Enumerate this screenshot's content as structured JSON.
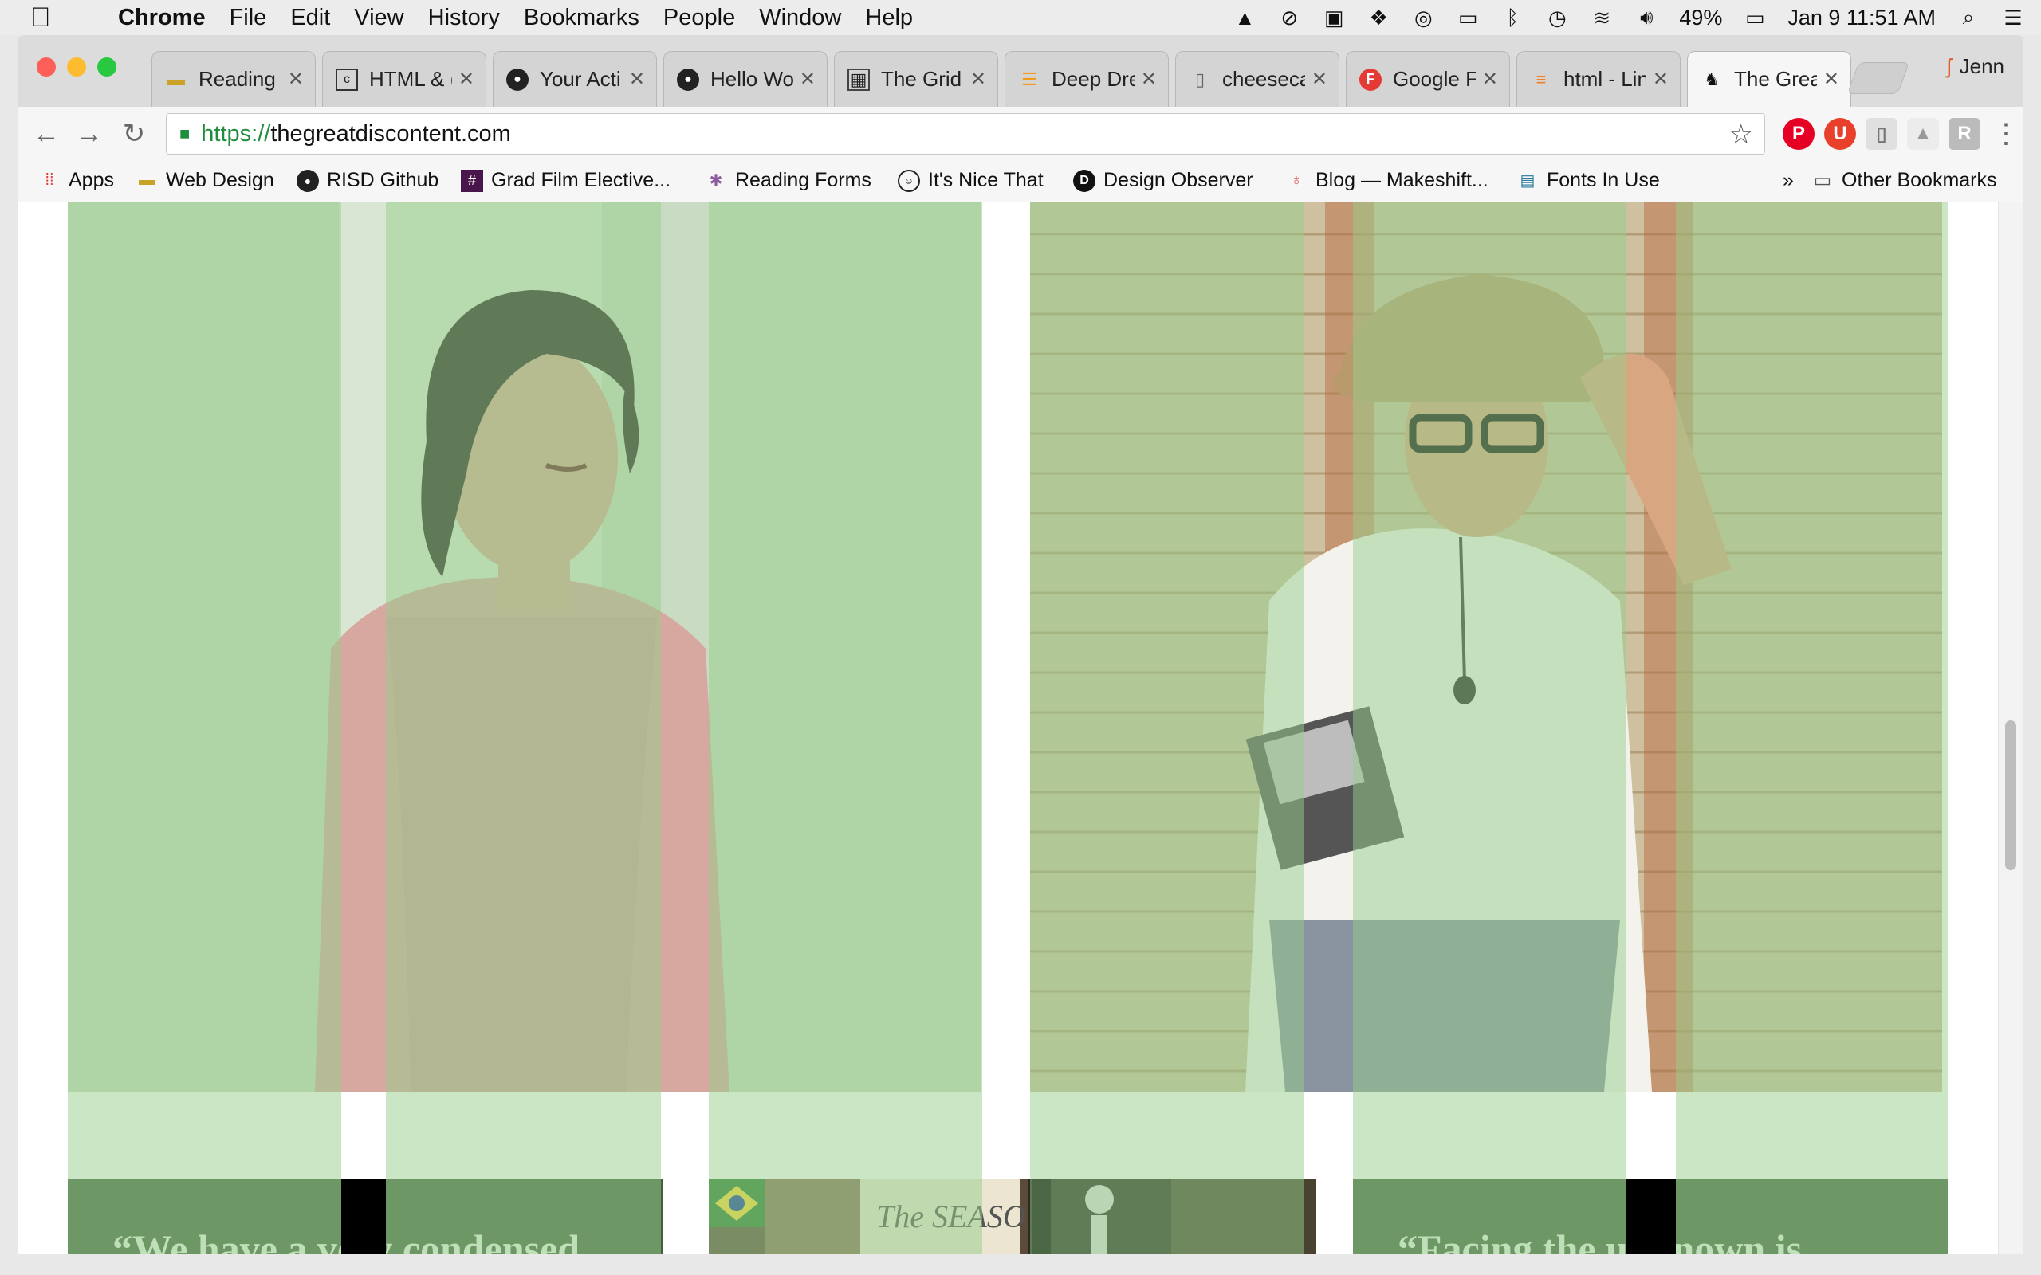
{
  "menubar": {
    "app_name": "Chrome",
    "items": [
      "File",
      "Edit",
      "View",
      "History",
      "Bookmarks",
      "People",
      "Window",
      "Help"
    ],
    "battery": "49%",
    "datetime": "Jan 9  11:51 AM"
  },
  "tabs": [
    {
      "label": "Reading",
      "icon": "laptop-icon"
    },
    {
      "label": "HTML & (",
      "icon": "codecademy-icon"
    },
    {
      "label": "Your Acti",
      "icon": "github-icon"
    },
    {
      "label": "Hello Wo",
      "icon": "github-icon"
    },
    {
      "label": "The Grid",
      "icon": "grid-icon"
    },
    {
      "label": "Deep Dre",
      "icon": "stack-icon"
    },
    {
      "label": "cheeseca",
      "icon": "document-icon"
    },
    {
      "label": "Google F",
      "icon": "google-fonts-icon"
    },
    {
      "label": "html - Lin",
      "icon": "stackoverflow-icon"
    },
    {
      "label": "The Grea",
      "icon": "great-discontent-icon",
      "active": true
    }
  ],
  "profile_name": "Jenn",
  "address_bar": {
    "protocol": "https://",
    "host": "thegreatdiscontent.com"
  },
  "bookmarks": [
    {
      "label": "Apps",
      "icon": "apps-grid-icon"
    },
    {
      "label": "Web Design",
      "icon": "laptop-icon"
    },
    {
      "label": "RISD Github",
      "icon": "github-icon"
    },
    {
      "label": "Grad Film Elective...",
      "icon": "slack-icon"
    },
    {
      "label": "Reading Forms",
      "icon": "reading-icon"
    },
    {
      "label": "It's Nice That",
      "icon": "its-nice-that-icon"
    },
    {
      "label": "Design Observer",
      "icon": "design-observer-icon"
    },
    {
      "label": "Blog — Makeshift...",
      "icon": "makeshift-icon"
    },
    {
      "label": "Fonts In Use",
      "icon": "fonts-in-use-icon"
    }
  ],
  "bookmarks_overflow": "»",
  "other_bookmarks": "Other Bookmarks",
  "content": {
    "quote_left": "“We have a very condensed",
    "quote_right": "“Facing the unknown is"
  },
  "colors": {
    "grid_overlay": "#96cd8c",
    "panel_green": "#44613c",
    "secure_green": "#1e8e3e"
  }
}
